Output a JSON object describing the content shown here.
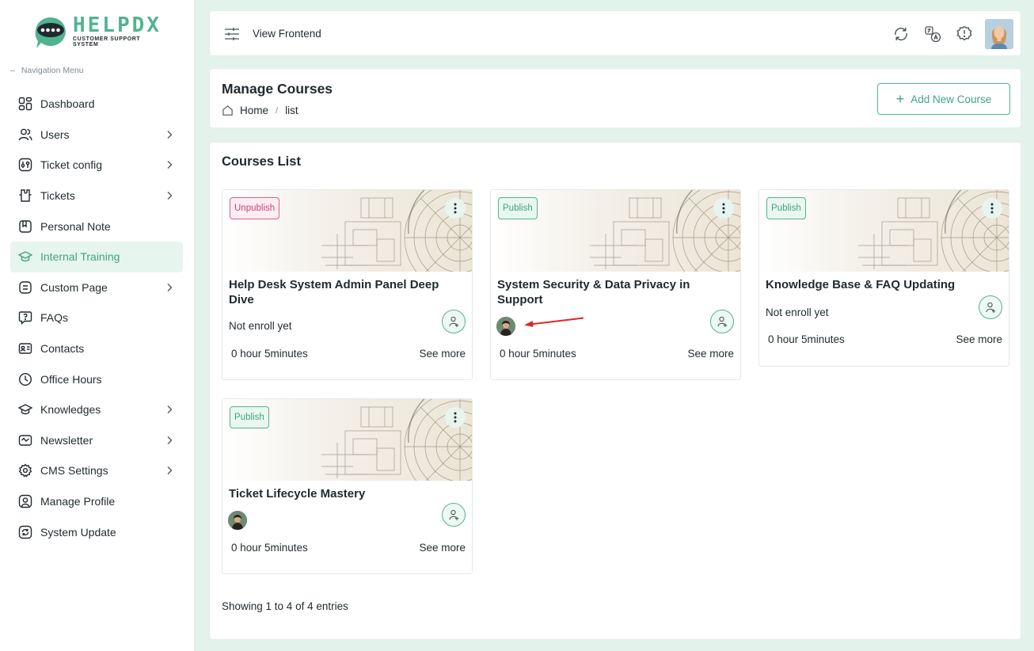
{
  "brand": {
    "title": "HELPDX",
    "subtitle": "CUSTOMER SUPPORT SYSTEM",
    "accent": "#4fb48f"
  },
  "sidebar": {
    "caption_dash": "–",
    "caption": "Navigation Menu",
    "items": [
      {
        "label": "Dashboard",
        "icon": "dashboard-icon",
        "chevron": false
      },
      {
        "label": "Users",
        "icon": "users-icon",
        "chevron": true
      },
      {
        "label": "Ticket config",
        "icon": "ticket-config-icon",
        "chevron": true
      },
      {
        "label": "Tickets",
        "icon": "tickets-icon",
        "chevron": true
      },
      {
        "label": "Personal Note",
        "icon": "note-icon",
        "chevron": false
      },
      {
        "label": "Internal Training",
        "icon": "training-icon",
        "chevron": false,
        "active": true
      },
      {
        "label": "Custom Page",
        "icon": "page-icon",
        "chevron": true
      },
      {
        "label": "FAQs",
        "icon": "faq-icon",
        "chevron": false
      },
      {
        "label": "Contacts",
        "icon": "contacts-icon",
        "chevron": false
      },
      {
        "label": "Office Hours",
        "icon": "clock-icon",
        "chevron": false
      },
      {
        "label": "Knowledges",
        "icon": "knowledge-icon",
        "chevron": true
      },
      {
        "label": "Newsletter",
        "icon": "newsletter-icon",
        "chevron": true
      },
      {
        "label": "CMS Settings",
        "icon": "gear-icon",
        "chevron": true
      },
      {
        "label": "Manage Profile",
        "icon": "profile-icon",
        "chevron": false
      },
      {
        "label": "System Update",
        "icon": "update-icon",
        "chevron": false
      }
    ]
  },
  "topbar": {
    "view_frontend": "View Frontend",
    "icons": [
      "sync-icon",
      "translate-icon",
      "alert-icon",
      "user-avatar"
    ]
  },
  "header": {
    "title": "Manage Courses",
    "breadcrumb_home": "Home",
    "breadcrumb_sep": "/",
    "breadcrumb_current": "list",
    "add_button": "Add New Course"
  },
  "courses_section": {
    "title": "Courses List",
    "entries": "Showing 1 to 4 of 4 entries"
  },
  "courses": [
    {
      "status": "Unpublish",
      "title": "Help Desk System Admin Panel Deep Dive",
      "enroll": "Not enroll yet",
      "duration": "0 hour 5minutes",
      "see_more": "See more"
    },
    {
      "status": "Publish",
      "title": "System Security & Data Privacy in Support",
      "enroll": "",
      "duration": "0 hour 5minutes",
      "see_more": "See more"
    },
    {
      "status": "Publish",
      "title": "Knowledge Base & FAQ Updating",
      "enroll": "Not enroll yet",
      "duration": "0 hour 5minutes",
      "see_more": "See more"
    },
    {
      "status": "Publish",
      "title": "Ticket Lifecycle Mastery",
      "enroll": "",
      "duration": "0 hour 5minutes",
      "see_more": "See more"
    }
  ]
}
